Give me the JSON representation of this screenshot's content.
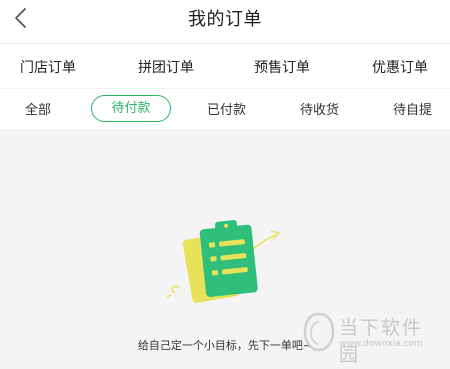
{
  "header": {
    "title": "我的订单",
    "back_icon": "chevron-left-icon"
  },
  "tabs": [
    {
      "label": "门店订单"
    },
    {
      "label": "拼团订单"
    },
    {
      "label": "预售订单"
    },
    {
      "label": "优惠订单"
    }
  ],
  "subtabs": {
    "active_index": 1,
    "items": [
      {
        "label": "全部"
      },
      {
        "label": "待付款"
      },
      {
        "label": "已付款"
      },
      {
        "label": "待收货"
      },
      {
        "label": "待自提"
      }
    ]
  },
  "empty_state": {
    "icon": "clipboard-icon",
    "message": "给自己定一个小目标，先下一单吧~"
  },
  "watermark": {
    "brand": "当下软件园",
    "url": "www.downxia.com"
  },
  "colors": {
    "accent": "#2fb36a",
    "clipboard": "#2fbf7b",
    "clipboard_back": "#e8e25a",
    "background": "#f4f4f4"
  }
}
